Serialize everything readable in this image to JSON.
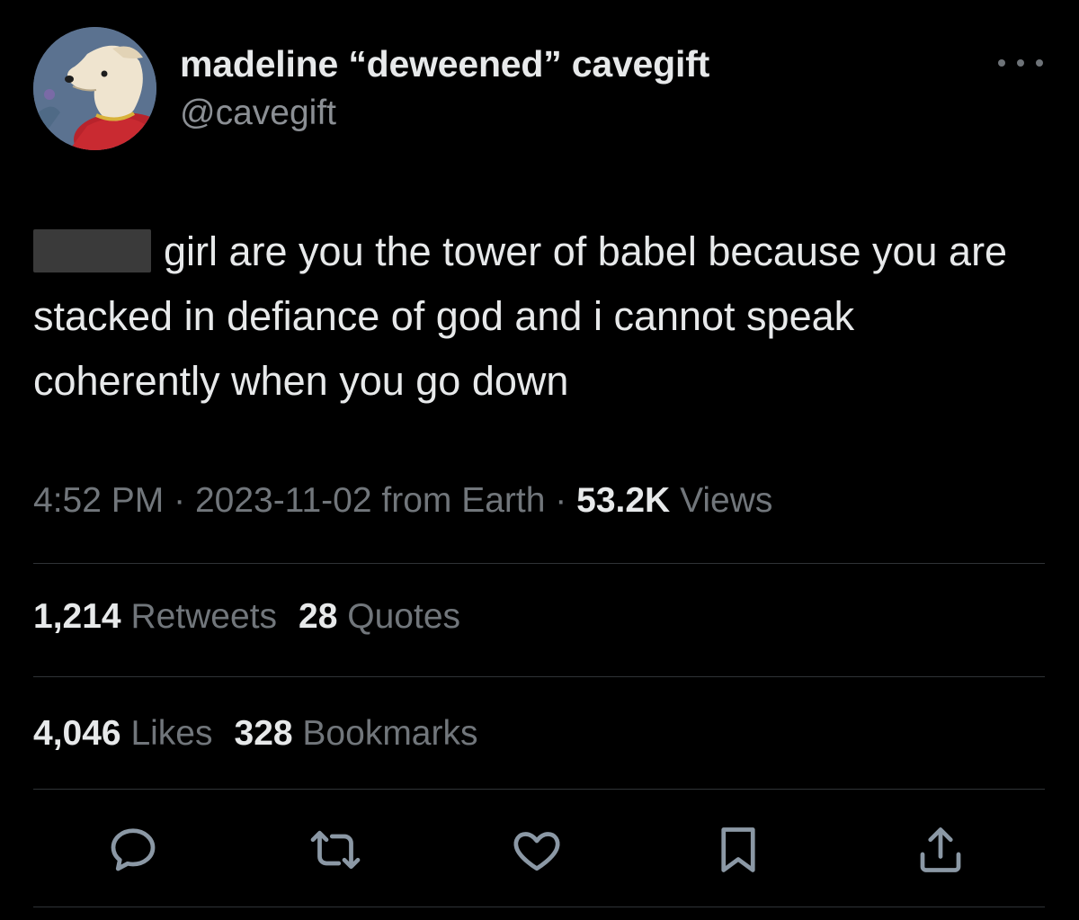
{
  "author": {
    "display_name": "madeline “deweened” cavegift",
    "handle": "@cavegift"
  },
  "tweet": {
    "text": "girl are you the tower of babel because you are stacked in defiance of god and i cannot speak coherently when you go down"
  },
  "meta": {
    "time": "4:52 PM",
    "separator": "·",
    "date": "2023-11-02",
    "source": "from Earth",
    "views_count": "53.2K",
    "views_label": "Views"
  },
  "stats": {
    "retweets_count": "1,214",
    "retweets_label": "Retweets",
    "quotes_count": "28",
    "quotes_label": "Quotes",
    "likes_count": "4,046",
    "likes_label": "Likes",
    "bookmarks_count": "328",
    "bookmarks_label": "Bookmarks"
  },
  "actions": [
    {
      "icon": "reply-icon"
    },
    {
      "icon": "retweet-icon"
    },
    {
      "icon": "heart-icon"
    },
    {
      "icon": "bookmark-icon"
    },
    {
      "icon": "share-icon"
    }
  ],
  "colors": {
    "background": "#000000",
    "primary_text": "#e7e9ea",
    "secondary_text": "#71767b",
    "divider": "#2f3336",
    "icon": "#8b98a5"
  }
}
